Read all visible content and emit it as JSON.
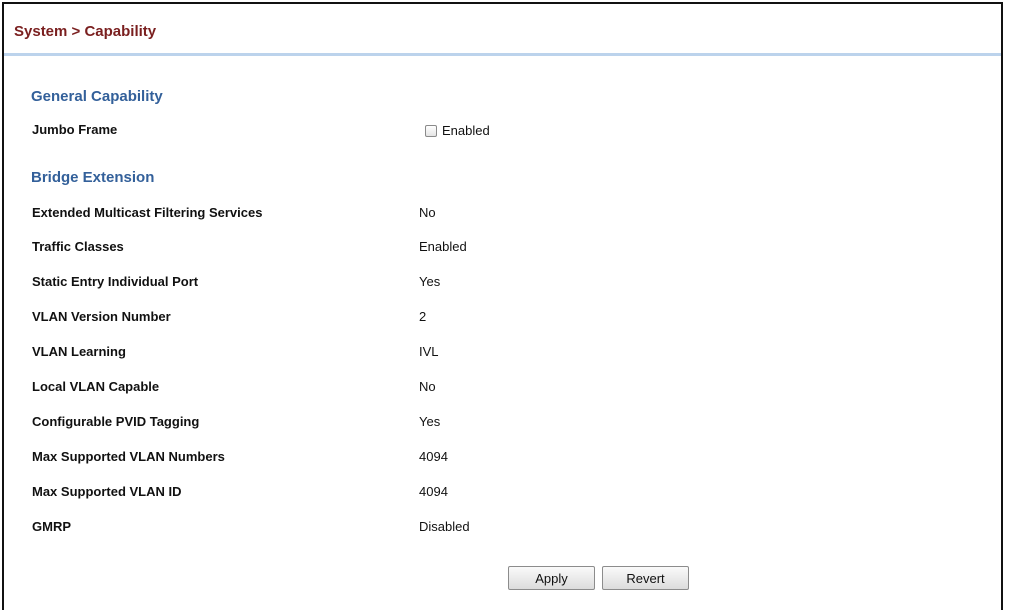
{
  "header": {
    "title": "System > Capability"
  },
  "general_capability": {
    "title": "General Capability",
    "jumbo_frame": {
      "label": "Jumbo Frame",
      "checkbox_label": "Enabled",
      "checked": false
    }
  },
  "bridge_extension": {
    "title": "Bridge Extension",
    "rows": [
      {
        "label": "Extended Multicast Filtering Services",
        "value": "No"
      },
      {
        "label": "Traffic Classes",
        "value": "Enabled"
      },
      {
        "label": "Static Entry Individual Port",
        "value": "Yes"
      },
      {
        "label": "VLAN Version Number",
        "value": "2"
      },
      {
        "label": "VLAN Learning",
        "value": "IVL"
      },
      {
        "label": "Local VLAN Capable",
        "value": "No"
      },
      {
        "label": "Configurable PVID Tagging",
        "value": "Yes"
      },
      {
        "label": "Max Supported VLAN Numbers",
        "value": "4094"
      },
      {
        "label": "Max Supported VLAN ID",
        "value": "4094"
      },
      {
        "label": "GMRP",
        "value": "Disabled"
      }
    ]
  },
  "buttons": {
    "apply": "Apply",
    "revert": "Revert"
  }
}
